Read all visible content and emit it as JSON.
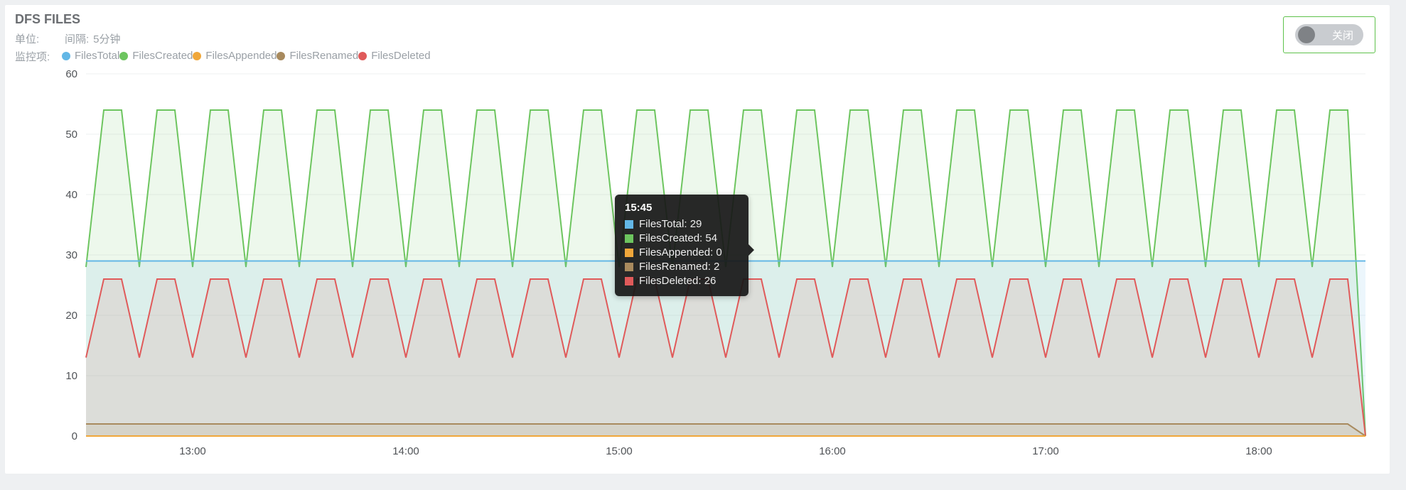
{
  "panel": {
    "title": "DFS FILES",
    "unit_label": "单位:",
    "unit_value": "",
    "interval_label": "间隔:",
    "interval_value": "5分钟",
    "monitor_label": "监控项:"
  },
  "toggle": {
    "label": "关闭"
  },
  "legend": [
    {
      "name": "FilesTotal",
      "color": "#63b7e6"
    },
    {
      "name": "FilesCreated",
      "color": "#6dc55f"
    },
    {
      "name": "FilesAppended",
      "color": "#f0a73a"
    },
    {
      "name": "FilesRenamed",
      "color": "#a88a5e"
    },
    {
      "name": "FilesDeleted",
      "color": "#e05a5a"
    }
  ],
  "tooltip": {
    "time": "15:45",
    "rows": [
      {
        "label": "FilesTotal",
        "value": 29,
        "color": "#63b7e6"
      },
      {
        "label": "FilesCreated",
        "value": 54,
        "color": "#6dc55f"
      },
      {
        "label": "FilesAppended",
        "value": 0,
        "color": "#f0a73a"
      },
      {
        "label": "FilesRenamed",
        "value": 2,
        "color": "#a88a5e"
      },
      {
        "label": "FilesDeleted",
        "value": 26,
        "color": "#e05a5a"
      }
    ]
  },
  "chart_data": {
    "type": "area",
    "title": "DFS FILES",
    "xlabel": "",
    "ylabel": "",
    "ylim": [
      0,
      60
    ],
    "y_ticks": [
      0,
      10,
      20,
      30,
      40,
      50,
      60
    ],
    "x_ticks": [
      "13:00",
      "14:00",
      "15:00",
      "16:00",
      "17:00",
      "18:00"
    ],
    "x_start": "12:30",
    "x_end": "18:30",
    "x_interval_minutes": 5,
    "tooltip_at": "15:45",
    "series": [
      {
        "name": "FilesTotal",
        "color": "#63b7e6",
        "pattern": "constant",
        "value": 29,
        "end_value": 29
      },
      {
        "name": "FilesCreated",
        "color": "#6dc55f",
        "pattern": "alternating",
        "high": 54,
        "low": 28,
        "period_minutes": 15,
        "end_value": 0
      },
      {
        "name": "FilesAppended",
        "color": "#f0a73a",
        "pattern": "constant",
        "value": 0,
        "end_value": 0
      },
      {
        "name": "FilesRenamed",
        "color": "#a88a5e",
        "pattern": "constant",
        "value": 2,
        "end_value": 0
      },
      {
        "name": "FilesDeleted",
        "color": "#e05a5a",
        "pattern": "alternating",
        "high": 26,
        "low": 13,
        "period_minutes": 15,
        "end_value": 0
      }
    ]
  }
}
